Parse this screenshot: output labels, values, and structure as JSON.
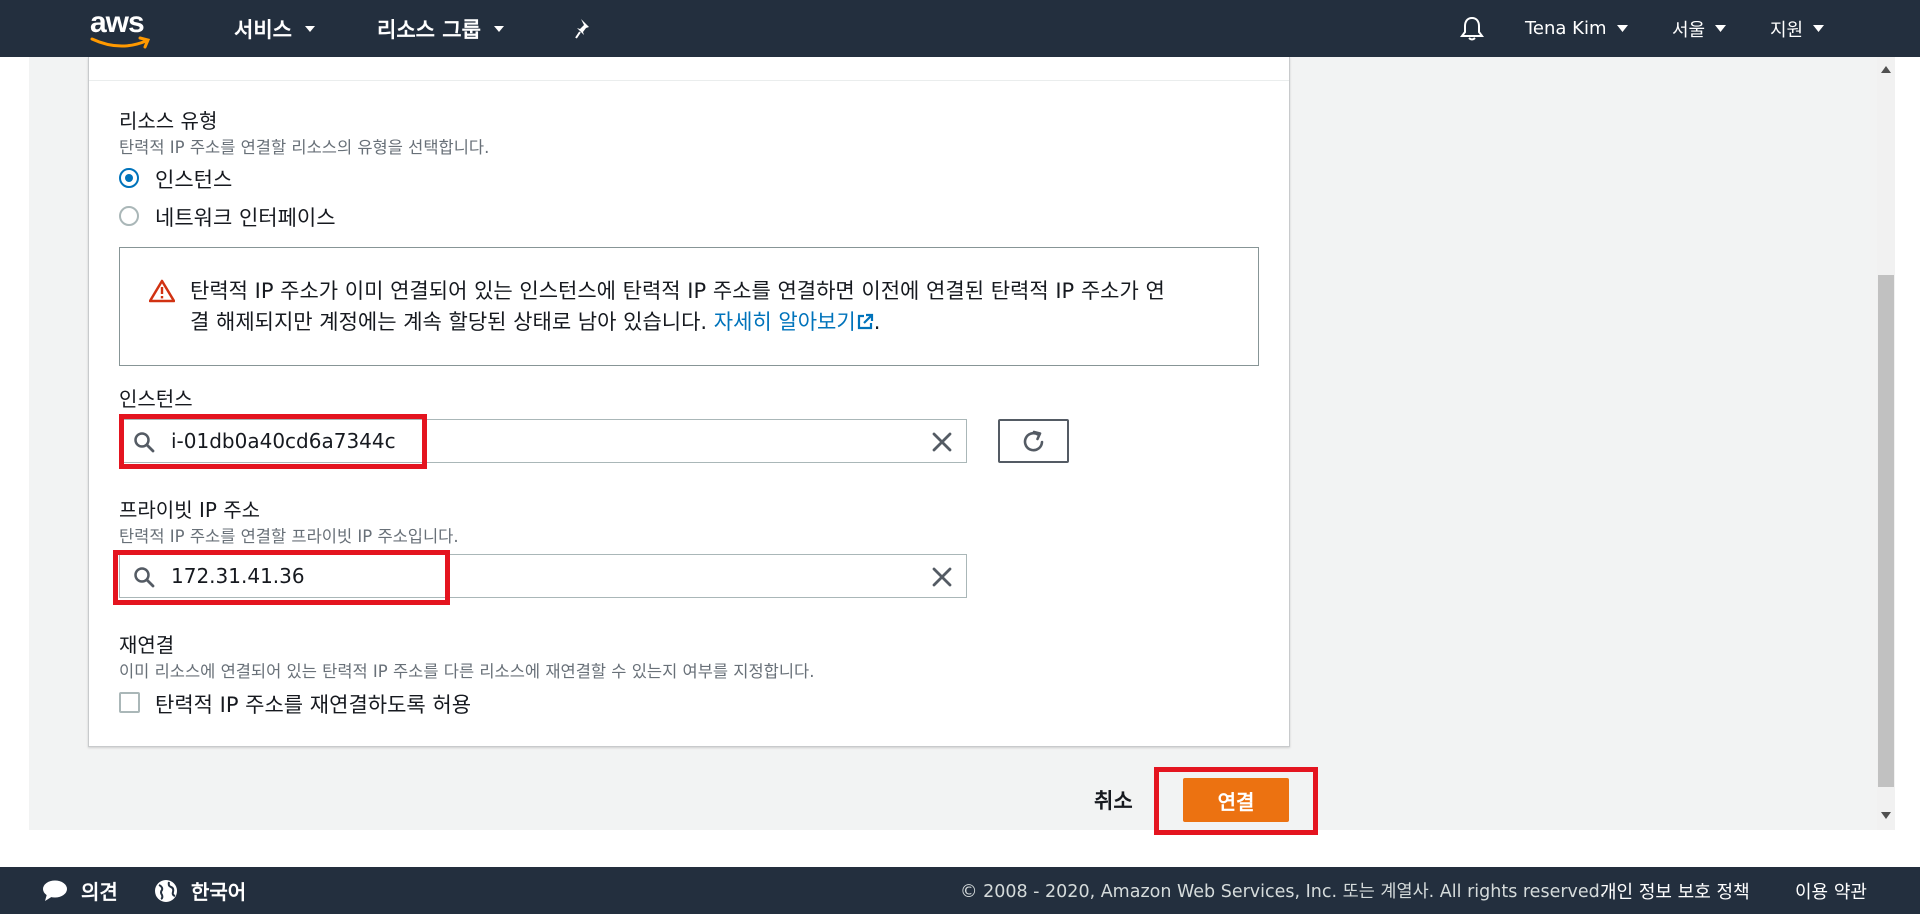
{
  "header": {
    "logo_text": "aws",
    "services_label": "서비스",
    "resource_groups_label": "리소스 그룹",
    "pin_icon": "pin-icon",
    "bell_icon": "bell-icon",
    "user_label": "Tena Kim",
    "region_label": "서울",
    "support_label": "지원"
  },
  "form": {
    "resource_type": {
      "label": "리소스 유형",
      "description": "탄력적 IP 주소를 연결할 리소스의 유형을 선택합니다.",
      "options": [
        {
          "label": "인스턴스",
          "selected": true
        },
        {
          "label": "네트워크 인터페이스",
          "selected": false
        }
      ]
    },
    "alert": {
      "icon": "warning-icon",
      "text_line1": "탄력적 IP 주소가 이미 연결되어 있는 인스턴스에 탄력적 IP 주소를 연결하면 이전에 연결된 탄력적 IP 주소가 연",
      "text_line2": "결 해제되지만 계정에는 계속 할당된 상태로 남아 있습니다.",
      "link_text": "자세히 알아보기",
      "trailing": "."
    },
    "instance": {
      "label": "인스턴스",
      "value": "i-01db0a40cd6a7344c"
    },
    "private_ip": {
      "label": "프라이빗 IP 주소",
      "description": "탄력적 IP 주소를 연결할 프라이빗 IP 주소입니다.",
      "value": "172.31.41.36"
    },
    "reassociation": {
      "label": "재연결",
      "description": "이미 리소스에 연결되어 있는 탄력적 IP 주소를 다른 리소스에 재연결할 수 있는지 여부를 지정합니다.",
      "checkbox_label": "탄력적 IP 주소를 재연결하도록 허용",
      "checked": false
    }
  },
  "actions": {
    "cancel_label": "취소",
    "connect_label": "연결"
  },
  "footer": {
    "feedback_label": "의견",
    "language_label": "한국어",
    "copyright": "© 2008 - 2020, Amazon Web Services, Inc. 또는 계열사. All rights reserved.",
    "privacy_label": "개인 정보 보호 정책",
    "terms_label": "이용 약관"
  },
  "colors": {
    "nav_bg": "#232f3e",
    "accent_orange": "#ec7211",
    "link_blue": "#0073bb",
    "highlight_red": "#e4141f"
  }
}
